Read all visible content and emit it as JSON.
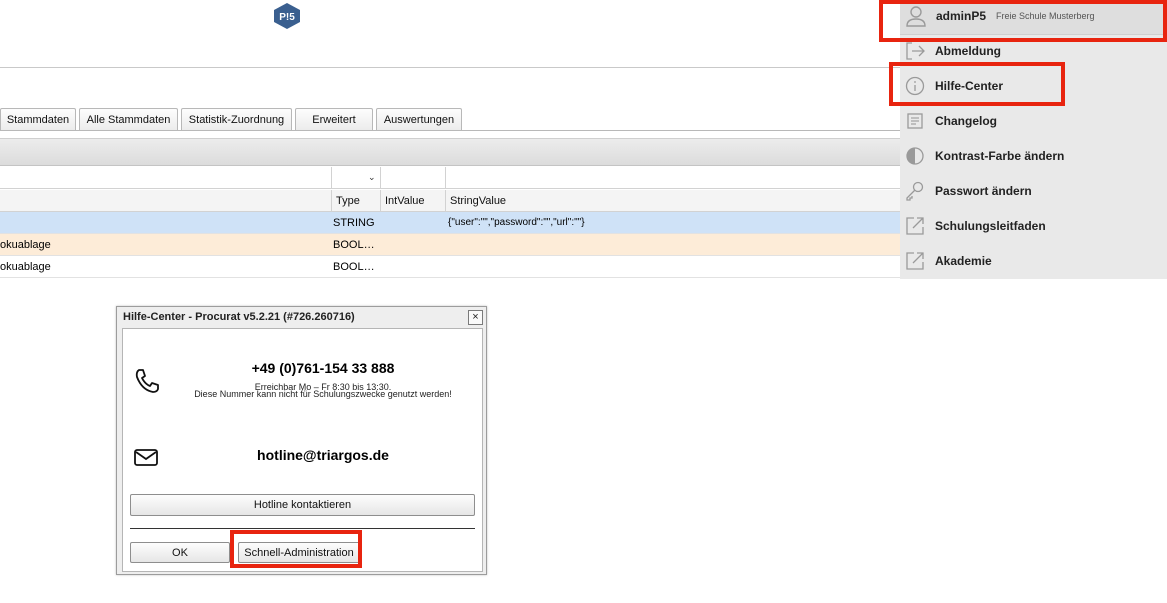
{
  "tabs": [
    "Stammdaten",
    "Alle Stammdaten",
    "Statistik-Zuordnung",
    "Erweitert",
    "Auswertungen"
  ],
  "filter": {
    "chevron": "⌄"
  },
  "table": {
    "columns": [
      "Type",
      "IntValue",
      "StringValue"
    ],
    "rows": [
      {
        "name": "",
        "type": "STRING",
        "int": "",
        "string": "{\"user\":\"\",\"password\":\"\",\"url\":\"\"}"
      },
      {
        "name": "okuablage",
        "type": "BOOL…",
        "int": "",
        "string": ""
      },
      {
        "name": "okuablage",
        "type": "BOOL…",
        "int": "",
        "string": ""
      }
    ]
  },
  "logo": {
    "text": "P!5",
    "color": "#3a5f8f"
  },
  "user_menu": {
    "user": "adminP5",
    "school": "Freie Schule Musterberg",
    "items": [
      {
        "label": "Abmeldung",
        "icon": "logout-icon"
      },
      {
        "label": "Hilfe-Center",
        "icon": "info-icon"
      },
      {
        "label": "Changelog",
        "icon": "document-icon"
      },
      {
        "label": "Kontrast-Farbe ändern",
        "icon": "contrast-icon"
      },
      {
        "label": "Passwort ändern",
        "icon": "key-icon"
      },
      {
        "label": "Schulungsleitfaden",
        "icon": "external-link-icon"
      },
      {
        "label": "Akademie",
        "icon": "external-link-icon"
      }
    ]
  },
  "dialog": {
    "title": "Hilfe-Center - Procurat v5.2.21 (#726.260716)",
    "close": "×",
    "phone": "+49 (0)761-154 33 888",
    "hours": "Erreichbar Mo – Fr 8:30 bis 13:30.",
    "note": "Diese Nummer kann nicht für Schulungszwecke genutzt werden!",
    "email": "hotline@triargos.de",
    "contact_button": "Hotline kontaktieren",
    "ok_button": "OK",
    "admin_button": "Schnell-Administration"
  },
  "highlight_color": "#e8240f"
}
